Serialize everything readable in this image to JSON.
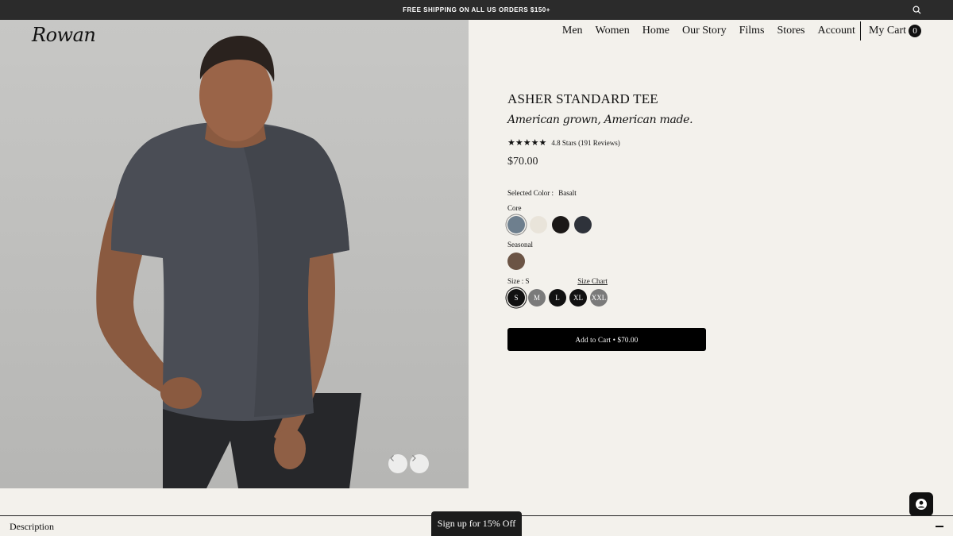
{
  "promo": {
    "text": "FREE SHIPPING ON ALL US ORDERS $150+"
  },
  "brand": {
    "logo": "Rowan"
  },
  "nav": {
    "items": [
      "Men",
      "Women",
      "Home",
      "Our Story",
      "Films",
      "Stores",
      "Account"
    ],
    "cart_label": "My Cart",
    "cart_count": "0"
  },
  "product": {
    "title": "ASHER STANDARD TEE",
    "tagline": "American grown, American made.",
    "rating_text": "4.8 Stars (191 Reviews)",
    "rating_stars": 5,
    "price": "$70.00",
    "selected_color_label": "Selected Color :",
    "selected_color_value": "Basalt",
    "core_label": "Core",
    "core_colors": [
      "#6e7f8e",
      "#e9e4da",
      "#1b1817",
      "#2e323a"
    ],
    "seasonal_label": "Seasonal",
    "seasonal_colors": [
      "#6b5445"
    ],
    "size_label": "Size : S",
    "size_chart_label": "Size Chart",
    "sizes": [
      {
        "label": "S",
        "state": "selected"
      },
      {
        "label": "M",
        "state": "sold"
      },
      {
        "label": "L",
        "state": "avail"
      },
      {
        "label": "XL",
        "state": "avail"
      },
      {
        "label": "XXL",
        "state": "sold"
      }
    ],
    "add_to_cart": "Add to Cart • $70.00"
  },
  "footer": {
    "description_label": "Description",
    "signup_label": "Sign up for 15% Off"
  },
  "icons": {
    "search": "search-icon",
    "prev": "chevron-left-icon",
    "next": "chevron-right-icon",
    "chat": "user-chat-icon",
    "collapse": "minus-icon"
  }
}
